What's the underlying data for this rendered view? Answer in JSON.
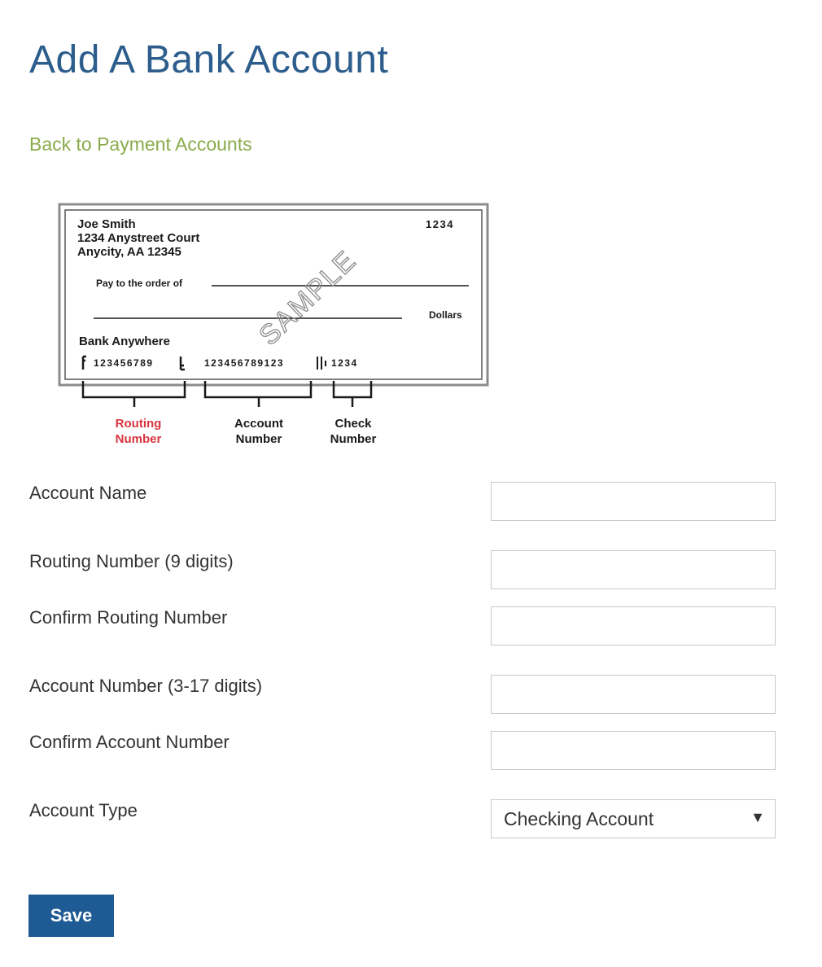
{
  "page": {
    "title": "Add A Bank Account",
    "back_link": "Back to Payment Accounts"
  },
  "check_image": {
    "name": "Joe Smith",
    "address_line1": "1234 Anystreet Court",
    "address_line2": "Anycity, AA 12345",
    "check_no": "1234",
    "pay_to": "Pay to the order of",
    "dollars": "Dollars",
    "bank": "Bank Anywhere",
    "routing_digits": "123456789",
    "account_digits": "123456789123",
    "check_digits": "1234",
    "watermark": "SAMPLE",
    "routing_label_1": "Routing",
    "routing_label_2": "Number",
    "account_label_1": "Account",
    "account_label_2": "Number",
    "check_label_1": "Check",
    "check_label_2": "Number",
    "colors": {
      "routing_label": "#d9343f",
      "ink": "#1a1a1a"
    }
  },
  "form": {
    "account_name_label": "Account Name",
    "routing_label": "Routing Number (9 digits)",
    "confirm_routing_label": "Confirm Routing Number",
    "account_number_label": "Account Number (3-17 digits)",
    "confirm_account_label": "Confirm Account Number",
    "account_type_label": "Account Type",
    "account_type_value": "Checking Account",
    "account_name_value": "",
    "routing_value": "",
    "confirm_routing_value": "",
    "account_number_value": "",
    "confirm_account_value": ""
  },
  "actions": {
    "save_label": "Save"
  },
  "colors": {
    "title": "#2c5d8c",
    "link": "#8aab4b",
    "button": "#1e5a93",
    "input_border": "#c9c9c9"
  }
}
